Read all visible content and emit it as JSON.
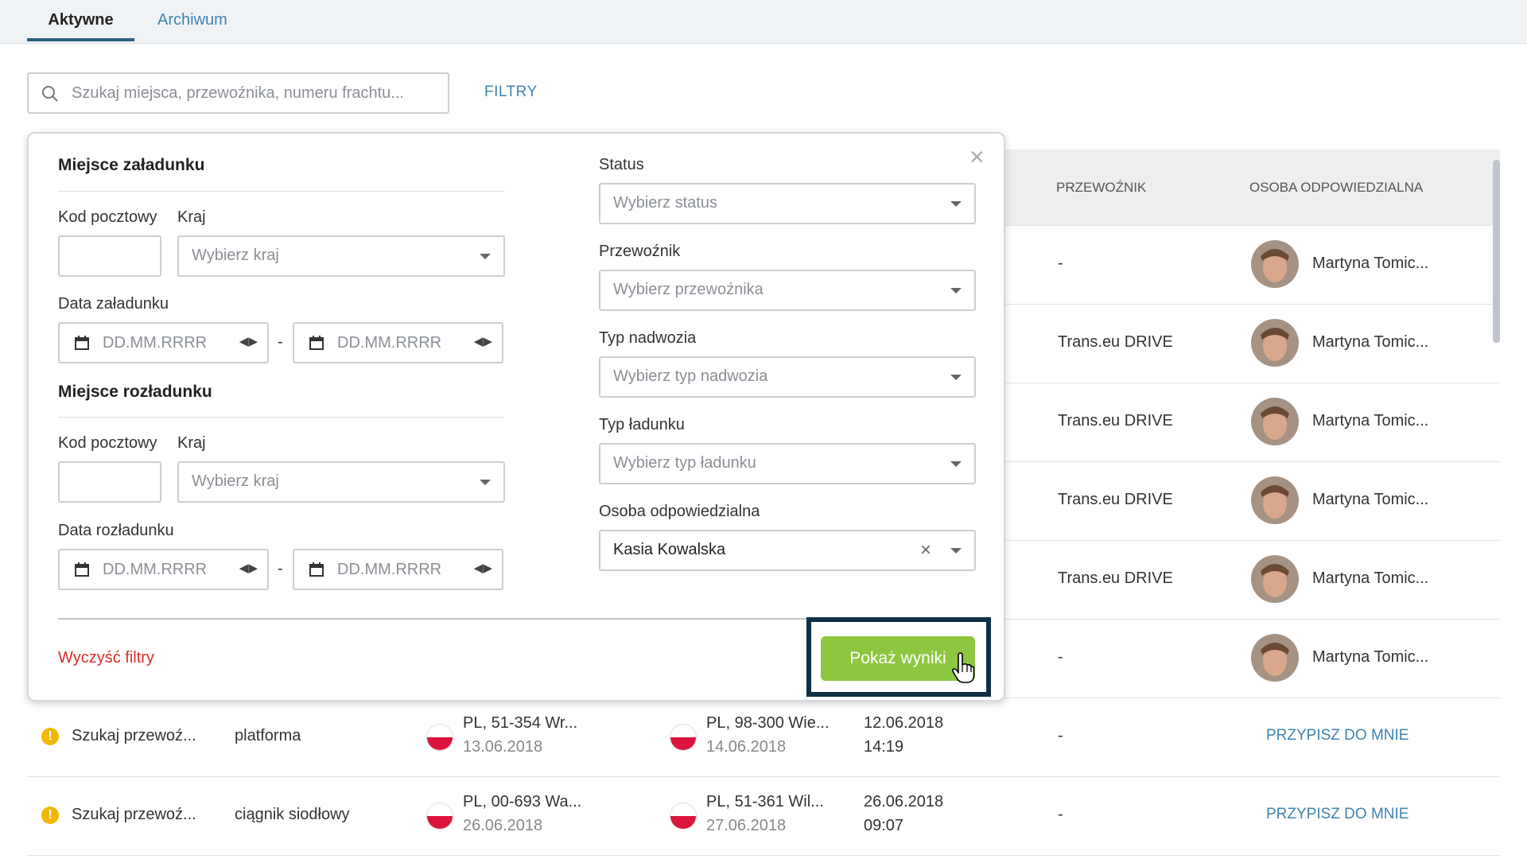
{
  "tabs": {
    "active": "Aktywne",
    "archive": "Archiwum"
  },
  "search": {
    "placeholder": "Szukaj miejsca, przewoźnika, numeru frachtu..."
  },
  "filters_link": "FILTRY",
  "table": {
    "headers": {
      "carrier": "PRZEWOŹNIK",
      "responsible": "OSOBA ODPOWIEDZIALNA"
    },
    "rows": [
      {
        "carrier": "-",
        "person": "Martyna Tomic..."
      },
      {
        "carrier": "Trans.eu DRIVE",
        "person": "Martyna Tomic..."
      },
      {
        "carrier": "Trans.eu DRIVE",
        "person": "Martyna Tomic..."
      },
      {
        "carrier": "Trans.eu DRIVE",
        "person": "Martyna Tomic..."
      },
      {
        "carrier": "Trans.eu DRIVE",
        "person": "Martyna Tomic..."
      },
      {
        "carrier": "-",
        "person": "Martyna Tomic..."
      },
      {
        "status": "Szukaj przewoź...",
        "body": "platforma",
        "load_place": "PL, 51-354 Wr...",
        "load_date": "13.06.2018",
        "unload_place": "PL, 98-300 Wie...",
        "unload_date": "14.06.2018",
        "date": "12.06.2018",
        "time": "14:19",
        "carrier": "-",
        "assign": "PRZYPISZ DO MNIE"
      },
      {
        "status": "Szukaj przewoź...",
        "body": "ciągnik siodłowy",
        "load_place": "PL, 00-693 Wa...",
        "load_date": "26.06.2018",
        "unload_place": "PL, 51-361 Wil...",
        "unload_date": "27.06.2018",
        "date": "26.06.2018",
        "time": "09:07",
        "carrier": "-",
        "assign": "PRZYPISZ DO MNIE"
      }
    ]
  },
  "popup": {
    "loading_title": "Miejsce załadunku",
    "unloading_title": "Miejsce rozładunku",
    "postal_label": "Kod pocztowy",
    "country_label": "Kraj",
    "country_placeholder": "Wybierz kraj",
    "loading_date_label": "Data załadunku",
    "unloading_date_label": "Data rozładunku",
    "date_placeholder": "DD.MM.RRRR",
    "date_separator": "-",
    "status_label": "Status",
    "status_placeholder": "Wybierz status",
    "carrier_label": "Przewoźnik",
    "carrier_placeholder": "Wybierz przewoźnika",
    "body_label": "Typ nadwozia",
    "body_placeholder": "Wybierz typ nadwozia",
    "cargo_label": "Typ ładunku",
    "cargo_placeholder": "Wybierz typ ładunku",
    "responsible_label": "Osoba odpowiedzialna",
    "responsible_value": "Kasia Kowalska",
    "clear_filters": "Wyczyść filtry",
    "show_results": "Pokaż wyniki",
    "close_symbol": "×"
  },
  "colors": {
    "accent": "#3f83b0",
    "button_green": "#8dc63f",
    "danger": "#e02b2b",
    "highlight_frame": "#0e2f46",
    "warning": "#f2b705"
  }
}
